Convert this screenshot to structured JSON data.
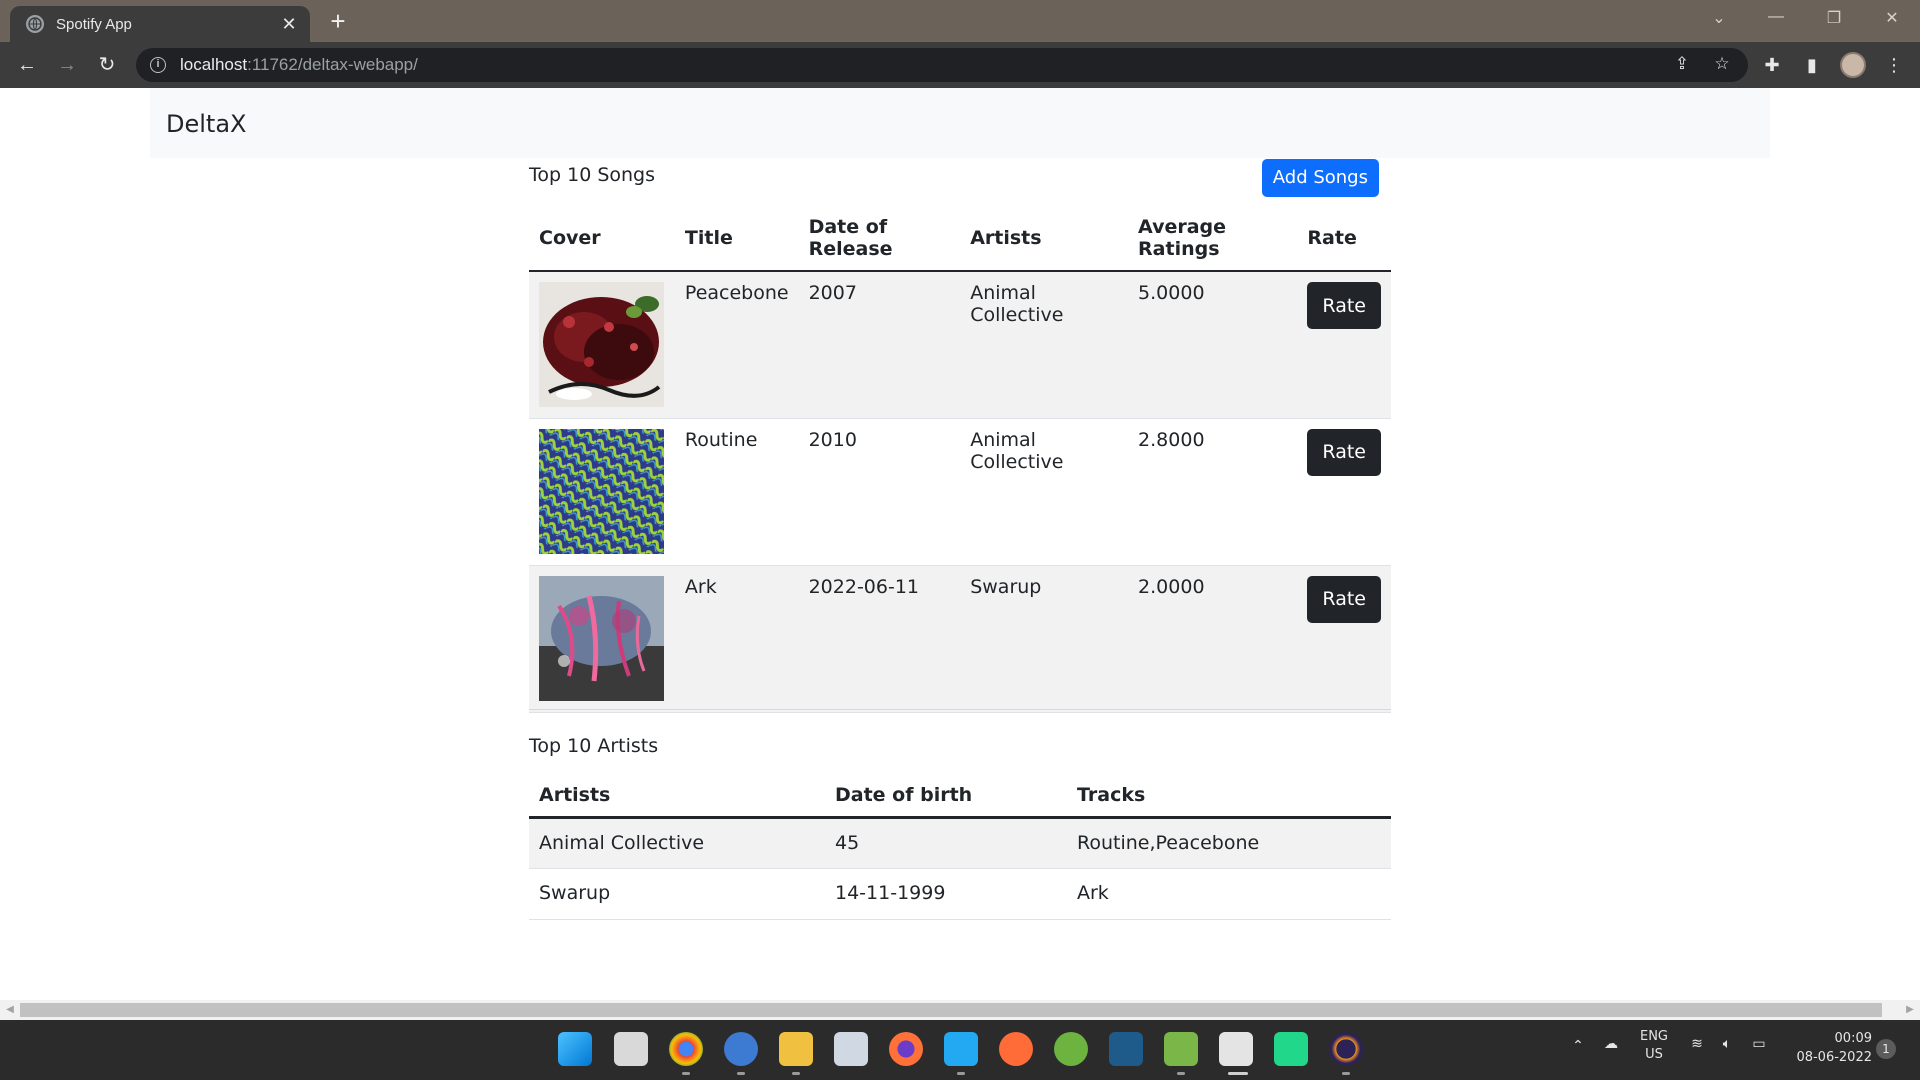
{
  "browser": {
    "tab_title": "Spotify App",
    "url_host": "localhost",
    "url_path": ":11762/deltax-webapp/"
  },
  "navbar": {
    "brand": "DeltaX"
  },
  "songs": {
    "title": "Top 10 Songs",
    "add_button": "Add Songs",
    "headers": [
      "Cover",
      "Title",
      "Date of Release",
      "Artists",
      "Average Ratings",
      "Rate"
    ],
    "rows": [
      {
        "title": "Peacebone",
        "release": "2007",
        "artists": "Animal Collective",
        "rating": "5.0000",
        "rate_label": "Rate"
      },
      {
        "title": "Routine",
        "release": "2010",
        "artists": "Animal Collective",
        "rating": "2.8000",
        "rate_label": "Rate"
      },
      {
        "title": "Ark",
        "release": "2022-06-11",
        "artists": "Swarup",
        "rating": "2.0000",
        "rate_label": "Rate"
      }
    ]
  },
  "artists": {
    "title": "Top 10 Artists",
    "headers": [
      "Artists",
      "Date of birth",
      "Tracks"
    ],
    "rows": [
      {
        "name": "Animal Collective",
        "dob": "45",
        "tracks": "Routine,Peacebone"
      },
      {
        "name": "Swarup",
        "dob": "14-11-1999",
        "tracks": "Ark"
      }
    ]
  },
  "taskbar": {
    "lang_top": "ENG",
    "lang_bottom": "US",
    "time": "00:09",
    "date": "08-06-2022",
    "notifications": "1"
  },
  "colors": {
    "primary": "#0d6efd",
    "dark": "#212529",
    "stripe": "#f2f2f2",
    "navbar_bg": "#f8f9fa"
  }
}
